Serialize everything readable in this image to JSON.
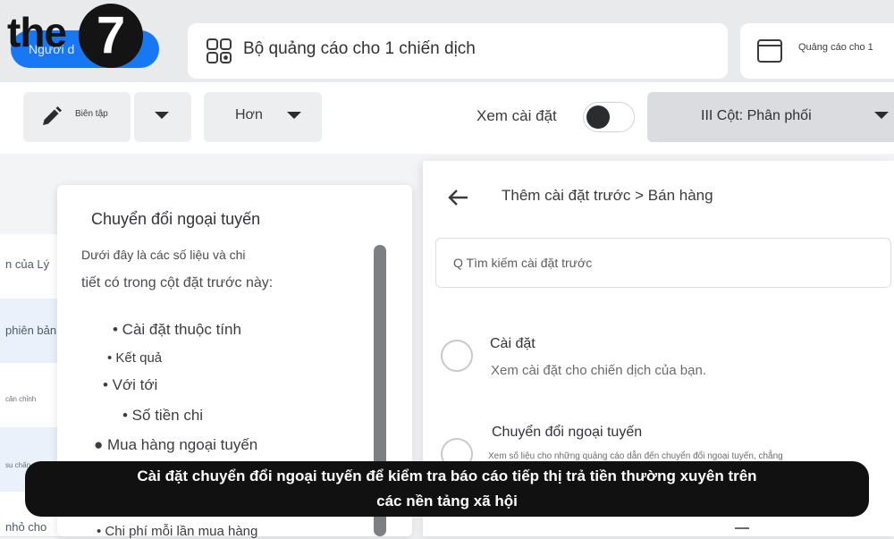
{
  "brand": {
    "logo_text": "the",
    "logo_number": "7"
  },
  "header": {
    "blue_button_label": "Người d",
    "adset_label": "Bộ quảng cáo cho 1 chiến dịch",
    "ad_label": "Quảng cáo cho 1"
  },
  "toolbar": {
    "edit_label": "Biên tập",
    "more_label": "Hơn",
    "view_settings_label": "Xem cài đặt",
    "view_settings_on": false,
    "columns_label": "III Cột: Phân phối"
  },
  "background_rows": [
    {
      "text": "n của Lý",
      "style": "normal"
    },
    {
      "text": "phiên bản",
      "style": "normal"
    },
    {
      "text": "cân chỉnh",
      "style": "small"
    },
    {
      "text": "su chấn",
      "style": "small"
    },
    {
      "text": "nhỏ cho",
      "style": "normal"
    }
  ],
  "popover": {
    "title": "Chuyển đổi ngoại tuyến",
    "desc_line1": "Dưới đây là các số liệu và chi",
    "desc_line2": "tiết có trong cột đặt trước này:",
    "items": [
      "• Cài đặt thuộc tính",
      "• Kết quả",
      "• Với tới",
      "• Số tiền chi",
      "●   Mua hàng ngoại tuyến",
      "• Chi phí mỗi lần mua hàng"
    ]
  },
  "preset_panel": {
    "breadcrumb": "Thêm cài đặt trước > Bán hàng",
    "search_placeholder": "Q Tìm kiếm cài đặt trước",
    "options": [
      {
        "title": "Cài đặt",
        "description": "Xem cài đặt cho chiến dịch của bạn."
      },
      {
        "title": "Chuyển đổi ngoại tuyến",
        "description": "Xem số liệu cho những quảng cáo dẫn đến chuyển đổi ngoại tuyến, chẳng"
      }
    ]
  },
  "caption": {
    "line1": "Cài đặt chuyển đổi ngoại tuyến để kiểm tra báo cáo tiếp thị trả tiền thường xuyên trên",
    "line2": "các nền tảng xã hội"
  },
  "colors": {
    "accent": "#1877f2",
    "caption_bg": "#111111"
  }
}
